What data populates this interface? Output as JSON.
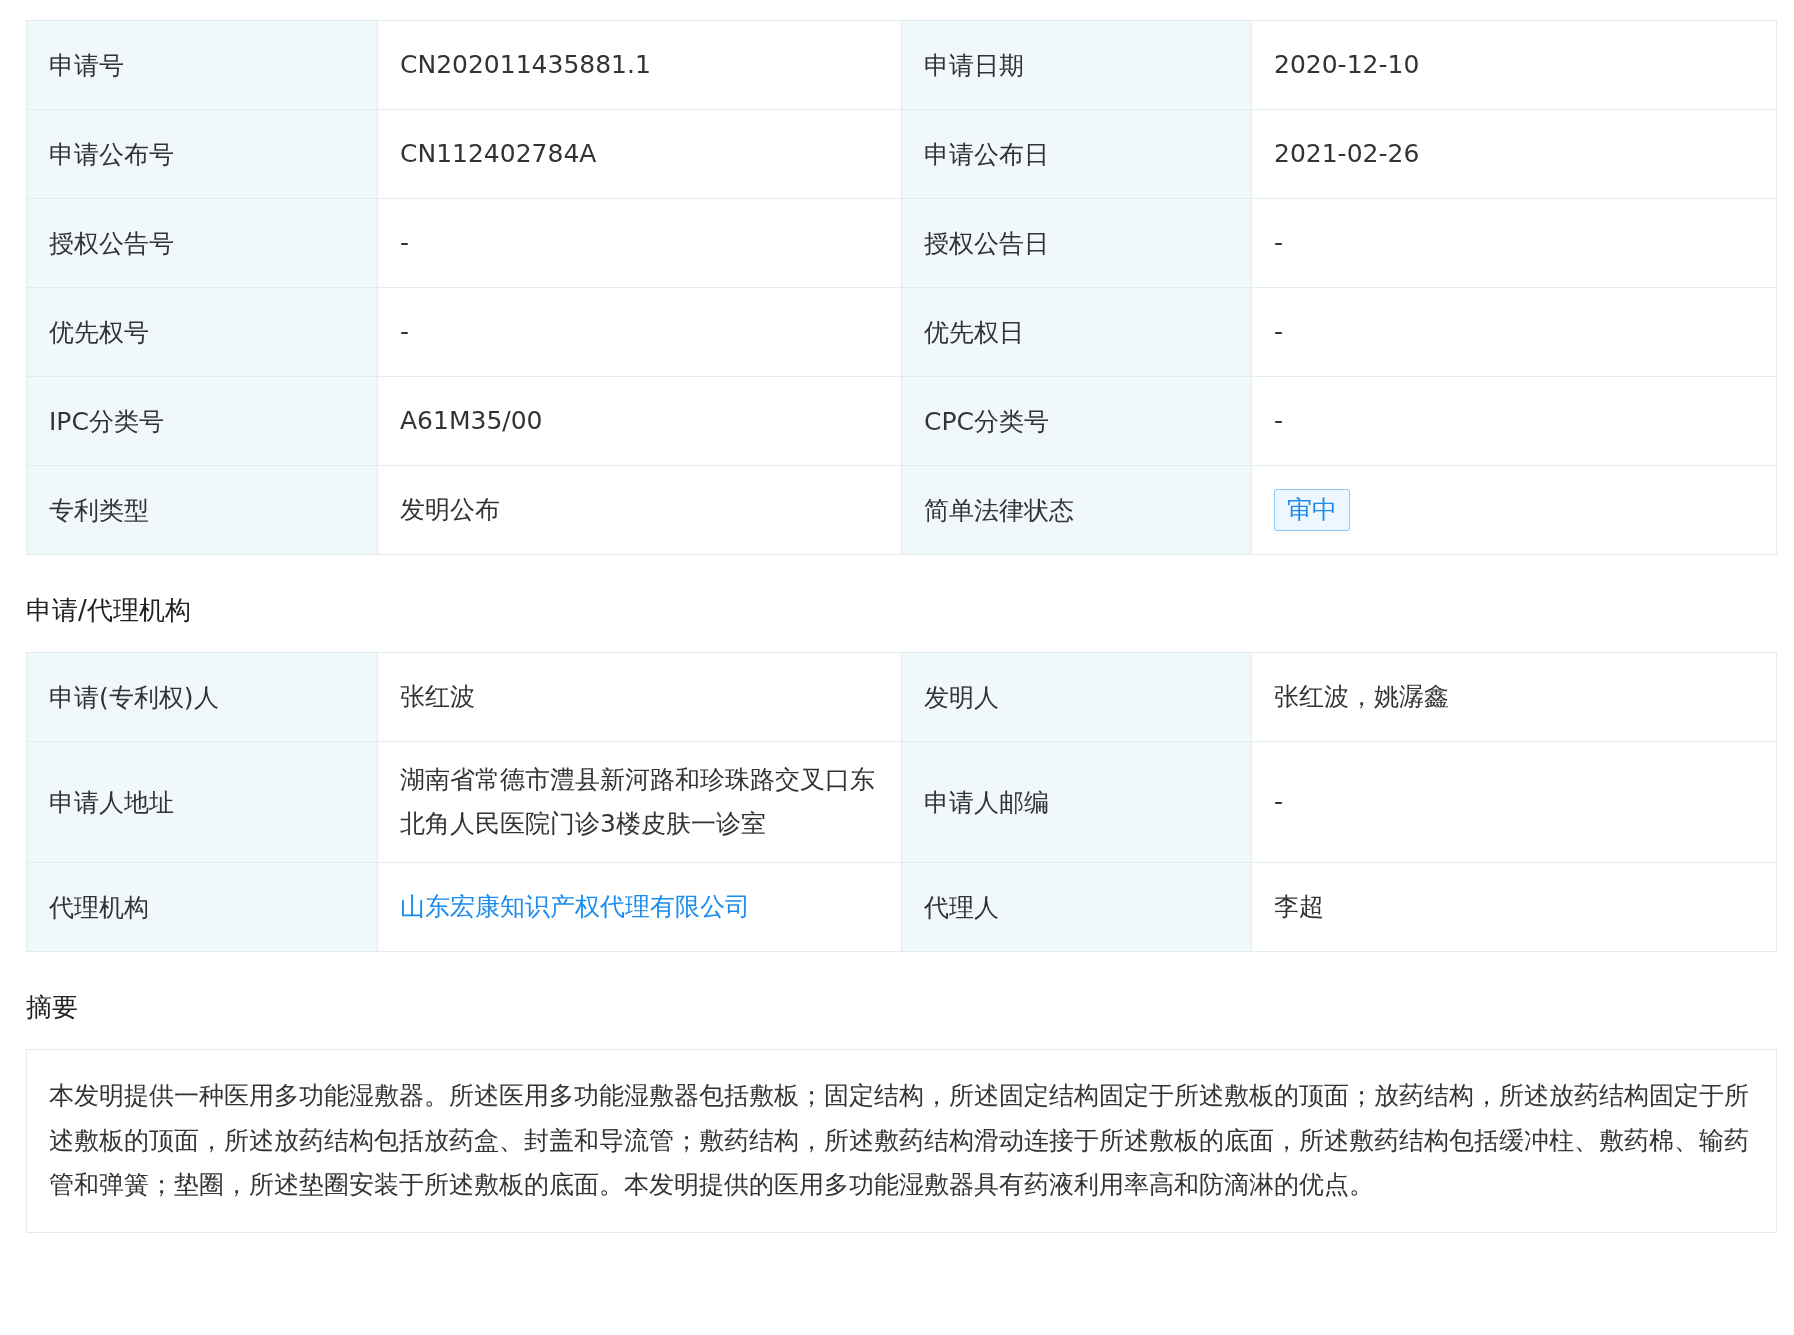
{
  "basic_table": {
    "rows": [
      {
        "cells": [
          {
            "label": "申请号",
            "value": "CN202011435881.1",
            "kind": "text"
          },
          {
            "label": "申请日期",
            "value": "2020-12-10",
            "kind": "text"
          }
        ]
      },
      {
        "cells": [
          {
            "label": "申请公布号",
            "value": "CN112402784A",
            "kind": "text"
          },
          {
            "label": "申请公布日",
            "value": "2021-02-26",
            "kind": "text"
          }
        ]
      },
      {
        "cells": [
          {
            "label": "授权公告号",
            "value": "-",
            "kind": "text"
          },
          {
            "label": "授权公告日",
            "value": "-",
            "kind": "text"
          }
        ]
      },
      {
        "cells": [
          {
            "label": "优先权号",
            "value": "-",
            "kind": "text"
          },
          {
            "label": "优先权日",
            "value": "-",
            "kind": "text"
          }
        ]
      },
      {
        "cells": [
          {
            "label": "IPC分类号",
            "value": "A61M35/00",
            "kind": "text"
          },
          {
            "label": "CPC分类号",
            "value": "-",
            "kind": "text"
          }
        ]
      },
      {
        "cells": [
          {
            "label": "专利类型",
            "value": "发明公布",
            "kind": "text"
          },
          {
            "label": "简单法律状态",
            "value": "审中",
            "kind": "tag"
          }
        ]
      }
    ]
  },
  "agency_section": {
    "title": "申请/代理机构",
    "rows": [
      {
        "cells": [
          {
            "label": "申请(专利权)人",
            "value": "张红波",
            "kind": "text"
          },
          {
            "label": "发明人",
            "value": "张红波，姚潺鑫",
            "kind": "text"
          }
        ]
      },
      {
        "cells": [
          {
            "label": "申请人地址",
            "value": "湖南省常德市澧县新河路和珍珠路交叉口东北角人民医院门诊3楼皮肤一诊室",
            "kind": "text"
          },
          {
            "label": "申请人邮编",
            "value": "-",
            "kind": "text"
          }
        ]
      },
      {
        "cells": [
          {
            "label": "代理机构",
            "value": "山东宏康知识产权代理有限公司",
            "kind": "link"
          },
          {
            "label": "代理人",
            "value": "李超",
            "kind": "text"
          }
        ]
      }
    ]
  },
  "abstract_section": {
    "title": "摘要",
    "text": "本发明提供一种医用多功能湿敷器。所述医用多功能湿敷器包括敷板；固定结构，所述固定结构固定于所述敷板的顶面；放药结构，所述放药结构固定于所述敷板的顶面，所述放药结构包括放药盒、封盖和导流管；敷药结构，所述敷药结构滑动连接于所述敷板的底面，所述敷药结构包括缓冲柱、敷药棉、输药管和弹簧；垫圈，所述垫圈安装于所述敷板的底面。本发明提供的医用多功能湿敷器具有药液利用率高和防滴淋的优点。"
  }
}
